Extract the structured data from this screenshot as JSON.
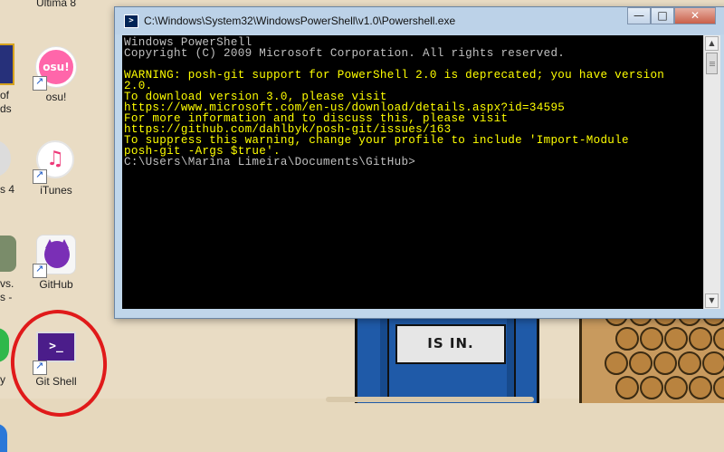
{
  "window": {
    "title": "C:\\Windows\\System32\\WindowsPowerShell\\v1.0\\Powershell.exe",
    "controls": {
      "minimize": "—",
      "maximize": "□",
      "close": "✕"
    }
  },
  "console": {
    "lines": [
      {
        "text": "Windows PowerShell",
        "color": "white"
      },
      {
        "text": "Copyright (C) 2009 Microsoft Corporation. All rights reserved.",
        "color": "white"
      },
      {
        "text": "",
        "color": "white"
      },
      {
        "text": "WARNING: posh-git support for PowerShell 2.0 is deprecated; you have version",
        "color": "yellow"
      },
      {
        "text": "2.0.",
        "color": "yellow"
      },
      {
        "text": "To download version 3.0, please visit",
        "color": "yellow"
      },
      {
        "text": "https://www.microsoft.com/en-us/download/details.aspx?id=34595",
        "color": "yellow"
      },
      {
        "text": "For more information and to discuss this, please visit",
        "color": "yellow"
      },
      {
        "text": "https://github.com/dahlbyk/posh-git/issues/163",
        "color": "yellow"
      },
      {
        "text": "To suppress this warning, change your profile to include 'Import-Module",
        "color": "yellow"
      },
      {
        "text": "posh-git -Args $true'.",
        "color": "yellow"
      },
      {
        "text": "C:\\Users\\Marina Limeira\\Documents\\GitHub>",
        "color": "white"
      }
    ]
  },
  "desktop": {
    "icons": [
      {
        "name": "osu",
        "label": "osu!",
        "glyph": "osu!"
      },
      {
        "name": "itunes",
        "label": "iTunes",
        "glyph": "♫"
      },
      {
        "name": "github",
        "label": "GitHub"
      },
      {
        "name": "git-shell",
        "label": "Git Shell",
        "glyph": ">_"
      }
    ],
    "partial_labels": {
      "top": "Última 8",
      "of": "of",
      "ds": "ds",
      "s4": "s 4",
      "vs": "vs.",
      "s_dash": "s -",
      "y": "y"
    }
  },
  "wallpaper": {
    "sign_text": "IS IN."
  },
  "colors": {
    "console_bg": "#000000",
    "console_white": "#c0c0c0",
    "console_yellow": "#ffff00",
    "annotation_circle": "#e01a1a"
  }
}
